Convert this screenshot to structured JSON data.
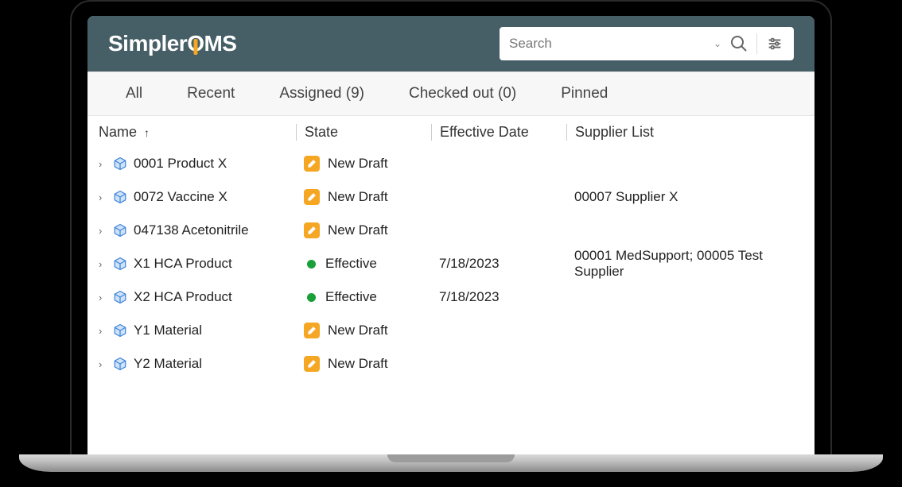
{
  "logo": {
    "part1": "Simpler",
    "part2": "MS"
  },
  "search": {
    "placeholder": "Search"
  },
  "tabs": {
    "all": "All",
    "recent": "Recent",
    "assigned": "Assigned (9)",
    "checked_out": "Checked out (0)",
    "pinned": "Pinned"
  },
  "columns": {
    "name": "Name",
    "state": "State",
    "effective_date": "Effective Date",
    "supplier": "Supplier List"
  },
  "state_labels": {
    "new_draft": "New Draft",
    "effective": "Effective"
  },
  "rows": [
    {
      "name": "0001 Product X",
      "state": "new_draft",
      "date": "",
      "supplier": ""
    },
    {
      "name": "0072 Vaccine X",
      "state": "new_draft",
      "date": "",
      "supplier": "00007 Supplier X"
    },
    {
      "name": "047138 Acetonitrile",
      "state": "new_draft",
      "date": "",
      "supplier": ""
    },
    {
      "name": "X1 HCA Product",
      "state": "effective",
      "date": "7/18/2023",
      "supplier": "00001 MedSupport; 00005 Test Supplier"
    },
    {
      "name": "X2 HCA Product",
      "state": "effective",
      "date": "7/18/2023",
      "supplier": ""
    },
    {
      "name": "Y1 Material",
      "state": "new_draft",
      "date": "",
      "supplier": ""
    },
    {
      "name": "Y2 Material",
      "state": "new_draft",
      "date": "",
      "supplier": ""
    }
  ]
}
